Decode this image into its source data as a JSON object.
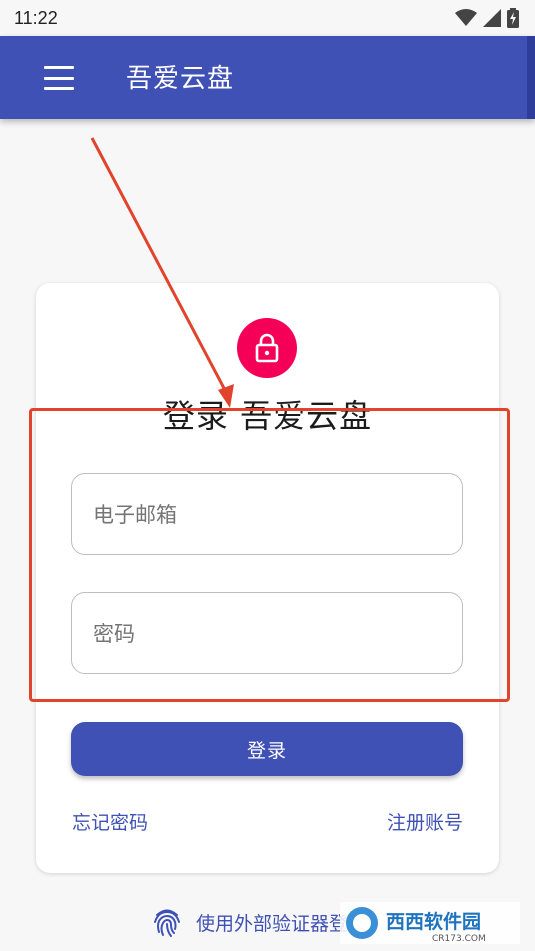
{
  "status_bar": {
    "time": "11:22"
  },
  "app_bar": {
    "title": "吾爱云盘"
  },
  "login_card": {
    "title": "登录 吾爱云盘",
    "email_placeholder": "电子邮箱",
    "password_placeholder": "密码",
    "login_button": "登录",
    "forgot_password": "忘记密码",
    "register": "注册账号"
  },
  "external_auth": {
    "label": "使用外部验证器登录"
  },
  "watermark": {
    "text": "西西软件园",
    "subtext": "CR173.COM"
  },
  "colors": {
    "primary": "#3f51b5",
    "accent": "#f50057",
    "annotation": "#e2432d"
  }
}
